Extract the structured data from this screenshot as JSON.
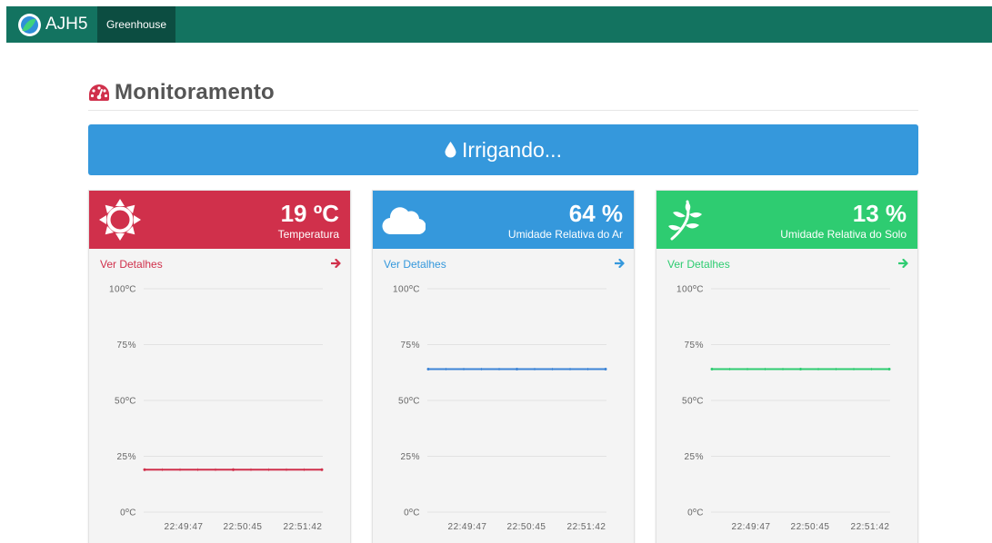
{
  "navbar": {
    "brand": "AJH5",
    "tab": "Greenhouse",
    "color": "#137360",
    "tab_color": "#0c4d41"
  },
  "header": {
    "icon": "dashboard-gauge-icon",
    "title": "Monitoramento"
  },
  "status": {
    "icon": "water-drop-icon",
    "text": "Irrigando...",
    "color": "#3598dc"
  },
  "cards": [
    {
      "id": "temperatura",
      "icon": "sun-icon",
      "value": "19 ºC",
      "label": "Temperatura",
      "color": "#d0304b",
      "details": "Ver Detalhes",
      "chart_y_labels": [
        "100ºC",
        "75%",
        "50ºC",
        "25%",
        "0ºC"
      ],
      "chart_x_labels": [
        "22:49:47",
        "22:50:45",
        "22:51:42"
      ]
    },
    {
      "id": "umidade-ar",
      "icon": "cloud-icon",
      "value": "64 %",
      "label": "Umidade Relativa do Ar",
      "color": "#3598dc",
      "details": "Ver Detalhes",
      "chart_y_labels": [
        "100ºC",
        "75%",
        "50ºC",
        "25%",
        "0ºC"
      ],
      "chart_x_labels": [
        "22:49:47",
        "22:50:45",
        "22:51:42"
      ]
    },
    {
      "id": "umidade-solo",
      "icon": "plant-icon",
      "value": "13 %",
      "label": "Umidade Relativa do Solo",
      "color": "#2ecc71",
      "details": "Ver Detalhes",
      "chart_y_labels": [
        "100ºC",
        "75%",
        "50ºC",
        "25%",
        "0ºC"
      ],
      "chart_x_labels": [
        "22:49:47",
        "22:50:45",
        "22:51:42"
      ]
    }
  ],
  "chart_data": [
    {
      "type": "line",
      "title": "",
      "x": [
        "22:49:47",
        "22:50:45",
        "22:51:42"
      ],
      "ylim": [
        0,
        100
      ],
      "series": [
        {
          "values": [
            19,
            19,
            19
          ],
          "color": "#d0304b"
        }
      ]
    },
    {
      "type": "line",
      "title": "",
      "x": [
        "22:49:47",
        "22:50:45",
        "22:51:42"
      ],
      "ylim": [
        0,
        100
      ],
      "series": [
        {
          "values": [
            64,
            64,
            64
          ],
          "color": "#3c84d6"
        }
      ]
    },
    {
      "type": "line",
      "title": "",
      "x": [
        "22:49:47",
        "22:50:45",
        "22:51:42"
      ],
      "ylim": [
        0,
        100
      ],
      "series": [
        {
          "values": [
            64,
            64,
            64
          ],
          "color": "#2ecc71"
        }
      ]
    }
  ]
}
